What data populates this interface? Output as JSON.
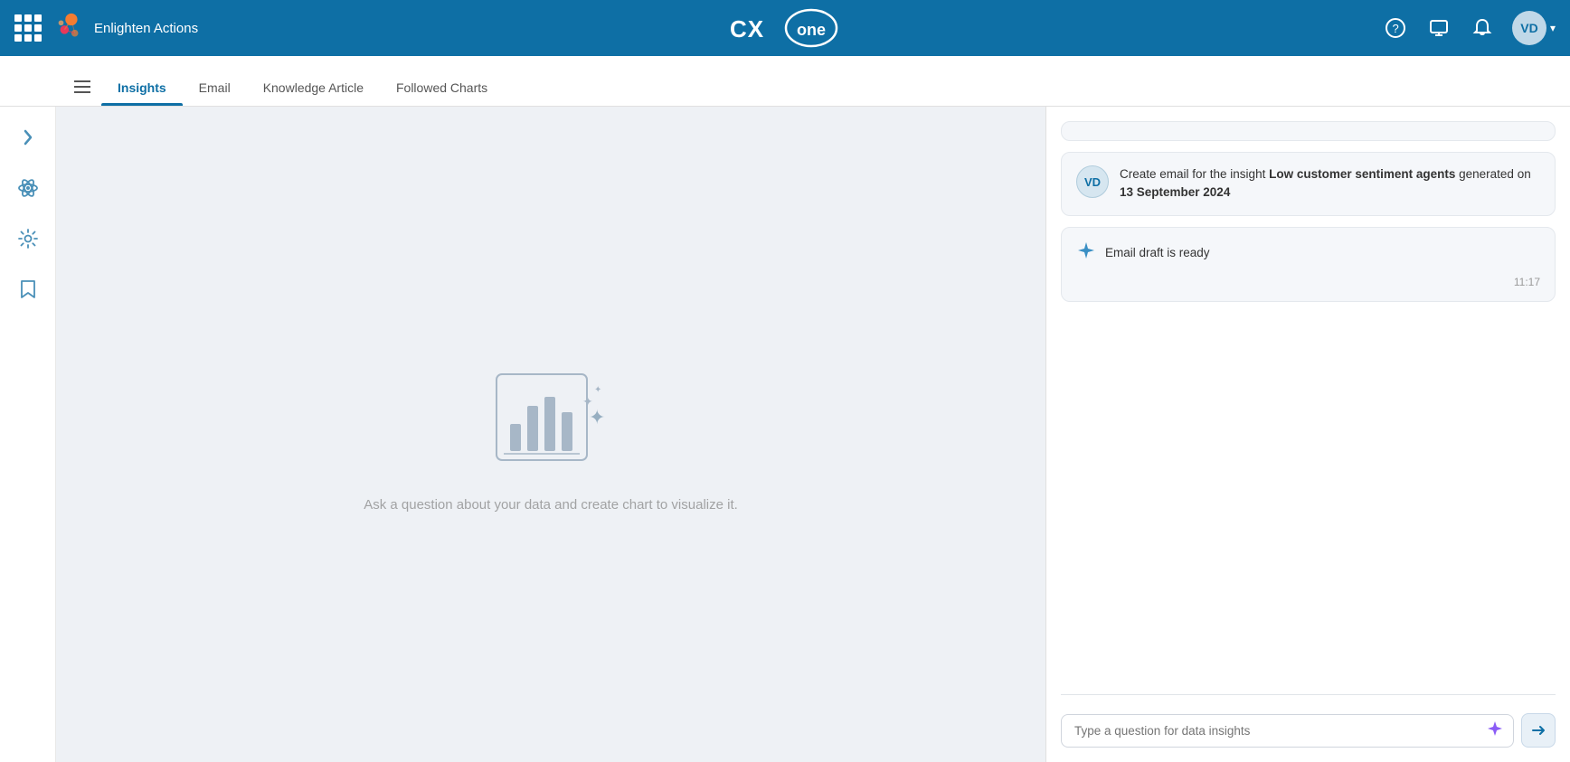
{
  "app": {
    "name": "Enlighten Actions",
    "logo_text": "CXone"
  },
  "nav_icons": {
    "help": "?",
    "monitor": "🖥",
    "bell": "🔔",
    "user_initials": "VD",
    "chevron": "▾"
  },
  "tabs": [
    {
      "id": "insights",
      "label": "Insights",
      "active": true
    },
    {
      "id": "email",
      "label": "Email",
      "active": false
    },
    {
      "id": "knowledge-article",
      "label": "Knowledge Article",
      "active": false
    },
    {
      "id": "followed-charts",
      "label": "Followed Charts",
      "active": false
    }
  ],
  "sidebar": {
    "items": [
      {
        "id": "expand",
        "icon": "›"
      },
      {
        "id": "atom",
        "icon": "⚛"
      },
      {
        "id": "settings",
        "icon": "⚙"
      },
      {
        "id": "bookmark",
        "icon": "🔖"
      }
    ]
  },
  "content": {
    "empty_text": "Ask a question about your data and create chart to visualize it."
  },
  "chat": {
    "messages": [
      {
        "type": "partial",
        "id": "msg-partial"
      },
      {
        "type": "user",
        "avatar": "VD",
        "text_prefix": "Create email for the insight ",
        "text_bold1": "Low customer sentiment agents",
        "text_middle": " generated on ",
        "text_bold2": "13 September 2024"
      },
      {
        "type": "ai",
        "text": "Email draft is ready",
        "time": "11:17"
      }
    ],
    "input_placeholder": "Type a question for data insights",
    "send_label": "Send"
  }
}
